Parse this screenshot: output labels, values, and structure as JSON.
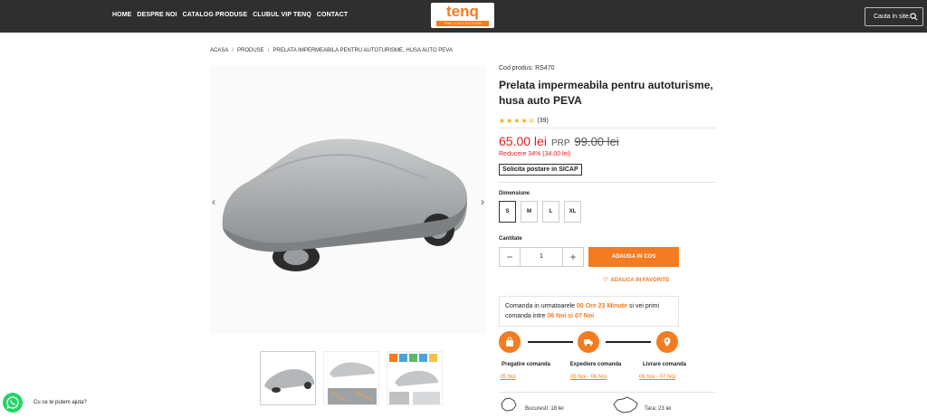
{
  "nav": {
    "items": [
      "HOME",
      "DESPRE NOI",
      "CATALOG PRODUSE",
      "CLUBUL VIP TENQ",
      "CONTACT"
    ],
    "logo_text": "tenq",
    "logo_tagline": "THE COLLECTION",
    "search_placeholder": "Cauta in site...",
    "accent": "#f47b20"
  },
  "breadcrumb": [
    "ACASA",
    "PRODUSE",
    "PRELATA IMPERMEABILA PENTRU AUTOTURISME, HUSA AUTO PEVA"
  ],
  "product": {
    "code": "Cod produs: RS470",
    "title": "Prelata impermeabila pentru autoturisme, husa auto PEVA",
    "rating_stars": 4.5,
    "reviews": "(39)",
    "price_new": "65.00 lei",
    "rrp_label": "PRP",
    "price_old": "99.00 lei",
    "discount": "Reducere 34% (34.00 lei)",
    "sicap": "Solicita postare in SICAP",
    "size_label": "Dimensiune",
    "sizes": [
      "S",
      "M",
      "L",
      "XL"
    ],
    "selected_size": "S",
    "qty_label": "Cantitate",
    "qty_value": "1",
    "add_to_cart": "ADAUGA IN COS",
    "add_to_fav": "ADAUGA IN FAVORITE"
  },
  "timer": {
    "prefix": "Comanda in urmatoarele",
    "countdown": "00 Ore 23 Minute",
    "middle": "si vei primi comanda intre",
    "window": "06 Noi si 07 Noi"
  },
  "steps": [
    {
      "label": "Pregatire comanda",
      "date": "05 Noi",
      "icon": "bag-icon"
    },
    {
      "label": "Expediere comanda",
      "date": "05 Noi - 06 Noi",
      "icon": "truck-icon"
    },
    {
      "label": "Livrare comanda",
      "date": "06 Noi - 07 Noi",
      "icon": "location-pin-icon"
    }
  ],
  "shipping": {
    "bucharest": "Bucuresti: 18 lei",
    "country": "Tara: 23 lei"
  },
  "chat": {
    "label": "Cu ce te putem ajuta?"
  }
}
